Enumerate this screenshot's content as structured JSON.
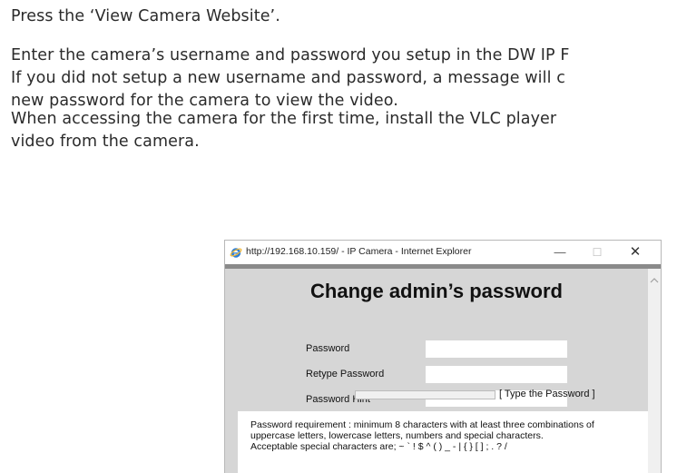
{
  "instructions": {
    "step1": "Press the ‘View Camera Website’.",
    "step2_line1": "Enter the camera’s username and password you setup in the DW IP F",
    "step2_line2": "If you did not setup a new username and password, a message will c",
    "step2_line3": "new password for the camera to view the video.",
    "step3_line1": "When accessing the camera for the first time, install the VLC player",
    "step3_line2": "video from the camera."
  },
  "window": {
    "title": "http://192.168.10.159/ - IP Camera - Internet Explorer",
    "minimize": "—",
    "maximize": "☐",
    "close": "✕"
  },
  "form": {
    "heading": "Change admin’s password",
    "fields": [
      {
        "label": "Password",
        "value": ""
      },
      {
        "label": "Retype Password",
        "value": ""
      },
      {
        "label": "Password Hint",
        "value": ""
      }
    ],
    "strength_label": "[ Type the Password ]",
    "requirements": {
      "line1": "Password requirement : minimum 8 characters with at least three combinations of",
      "line2": "uppercase letters, lowercase letters, numbers and special characters.",
      "line3": "Acceptable special characters are; ~ ` ! $ ^ ( ) _ - | { } [ ] ; . ? /"
    }
  },
  "colors": {
    "ie_blue": "#2f7fd6",
    "ie_ring": "#f2b632",
    "form_bg": "#d6d6d6",
    "topbar": "#8a8a8a"
  },
  "icons": {
    "browser": "internet-explorer-icon",
    "scroll": "scroll-up-arrow-icon"
  }
}
